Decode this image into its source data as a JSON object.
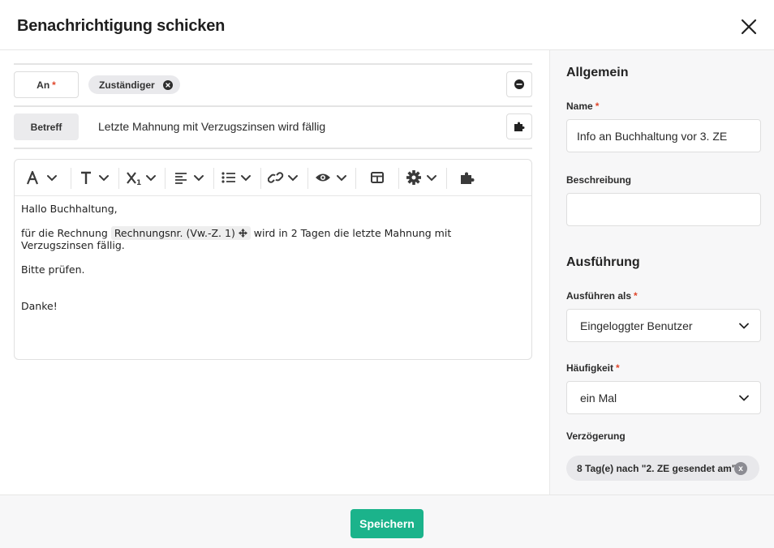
{
  "dialog": {
    "title": "Benachrichtigung schicken",
    "close_icon": "close-icon"
  },
  "recipient": {
    "label": "An",
    "required_mark": "*",
    "chip": "Zuständiger"
  },
  "subject": {
    "label": "Betreff",
    "value": "Letzte Mahnung mit Verzugszinsen wird fällig"
  },
  "toolbar": {
    "icons": [
      "font-color-icon",
      "text-format-icon",
      "subscript-icon",
      "align-icon",
      "list-icon",
      "link-icon",
      "preview-icon",
      "table-icon",
      "settings-icon",
      "plugin-icon"
    ]
  },
  "editor": {
    "greeting": "Hallo Buchhaltung,",
    "body_before": "für die Rechnung",
    "variable": "Rechnungsnr. (Vw.-Z. 1)",
    "body_after": "wird in 2 Tagen die letzte Mahnung mit Verzugszinsen fällig.",
    "check": "Bitte prüfen.",
    "thanks": "Danke!"
  },
  "sidebar": {
    "general_title": "Allgemein",
    "name_label": "Name",
    "name_value": "Info an Buchhaltung vor 3. ZE",
    "description_label": "Beschreibung",
    "description_value": "",
    "execution_title": "Ausführung",
    "run_as_label": "Ausführen als",
    "run_as_value": "Eingeloggter Benutzer",
    "frequency_label": "Häufigkeit",
    "frequency_value": "ein Mal",
    "delay_label": "Verzögerung",
    "delay_value": "8 Tag(e) nach \"2. ZE gesendet am\"",
    "delay_remove": "x",
    "required_mark": "*"
  },
  "footer": {
    "save_label": "Speichern",
    "save_color": "#1bb38b"
  }
}
